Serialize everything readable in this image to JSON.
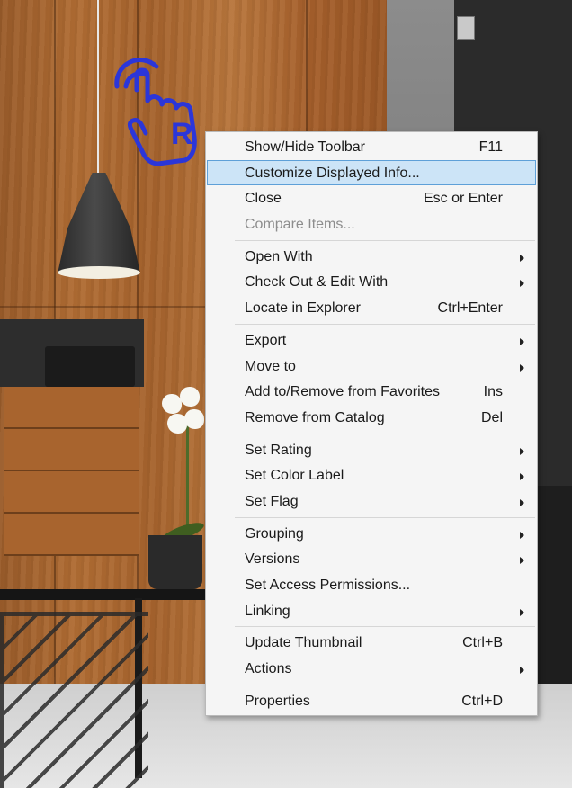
{
  "colors": {
    "menu_background": "#f5f5f5",
    "highlight_background": "#cce4f7",
    "highlight_border": "#5ea0d8",
    "disabled_text": "#8d8d8d",
    "icon_blue": "#2b36d9"
  },
  "cursor_icon": {
    "name": "right-click-hand-icon",
    "letter": "R"
  },
  "menu": {
    "groups": [
      [
        {
          "label": "Show/Hide Toolbar",
          "shortcut": "F11"
        },
        {
          "label": "Customize Displayed Info...",
          "shortcut": "",
          "highlighted": true
        },
        {
          "label": "Close",
          "shortcut": "Esc or Enter"
        },
        {
          "label": "Compare Items...",
          "shortcut": "",
          "disabled": true
        }
      ],
      [
        {
          "label": "Open With",
          "submenu": true
        },
        {
          "label": "Check Out & Edit With",
          "submenu": true
        },
        {
          "label": "Locate in Explorer",
          "shortcut": "Ctrl+Enter"
        }
      ],
      [
        {
          "label": "Export",
          "submenu": true
        },
        {
          "label": "Move to",
          "submenu": true
        },
        {
          "label": "Add to/Remove from Favorites",
          "shortcut": "Ins"
        },
        {
          "label": "Remove from Catalog",
          "shortcut": "Del"
        }
      ],
      [
        {
          "label": "Set Rating",
          "submenu": true
        },
        {
          "label": "Set Color Label",
          "submenu": true
        },
        {
          "label": "Set Flag",
          "submenu": true
        }
      ],
      [
        {
          "label": "Grouping",
          "submenu": true
        },
        {
          "label": "Versions",
          "submenu": true
        },
        {
          "label": "Set Access Permissions..."
        },
        {
          "label": "Linking",
          "submenu": true
        }
      ],
      [
        {
          "label": "Update Thumbnail",
          "shortcut": "Ctrl+B"
        },
        {
          "label": "Actions",
          "submenu": true
        }
      ],
      [
        {
          "label": "Properties",
          "shortcut": "Ctrl+D"
        }
      ]
    ]
  }
}
